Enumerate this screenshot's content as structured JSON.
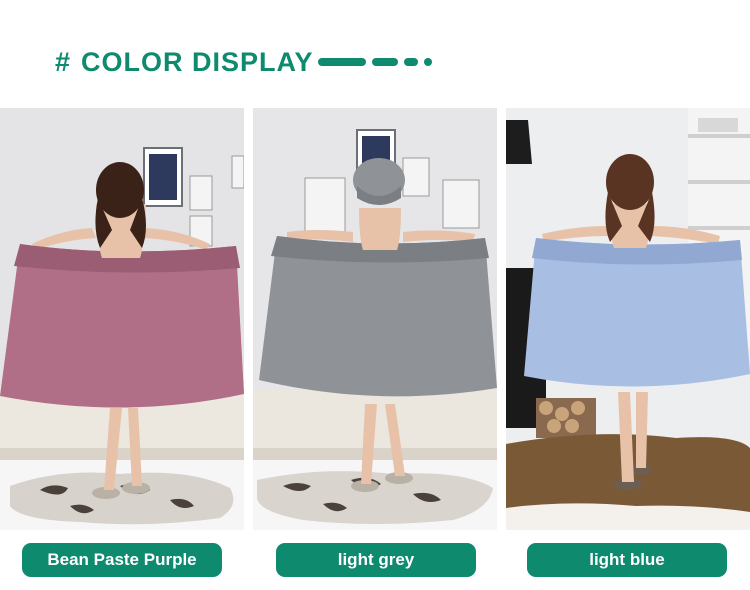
{
  "header": {
    "hash": "#",
    "title": "COLOR DISPLAY"
  },
  "options": [
    {
      "label": "Bean Paste Purple",
      "towel_color": "#b06f86",
      "towel_shade": "#9a5d73",
      "wall": "#e6e6e8",
      "floor": "#ffffff"
    },
    {
      "label": "light grey",
      "towel_color": "#8f9398",
      "towel_shade": "#7b7f84",
      "wall": "#e8e8ea",
      "floor": "#ffffff"
    },
    {
      "label": "light blue",
      "towel_color": "#a9bee3",
      "towel_shade": "#91a8d2",
      "wall": "#eceef0",
      "floor": "#ffffff"
    }
  ],
  "colors": {
    "accent": "#0e8a6e"
  }
}
